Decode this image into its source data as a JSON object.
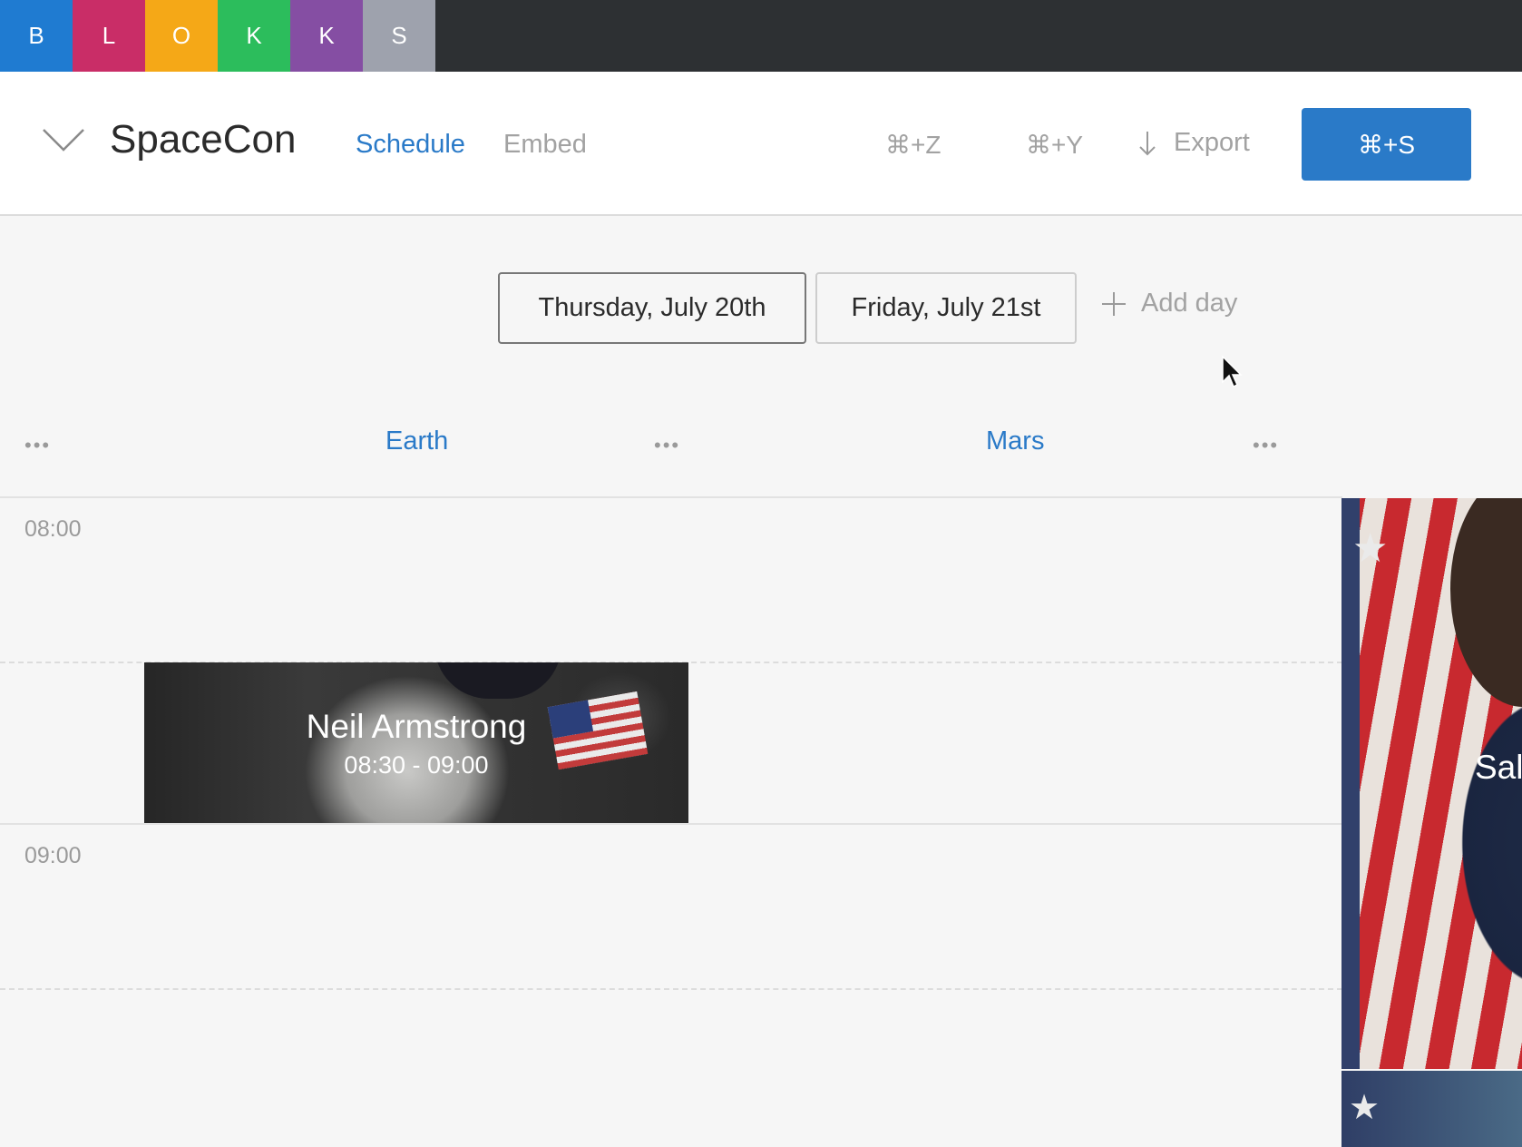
{
  "topbar": {
    "blocks": [
      {
        "letter": "B",
        "color": "#1f7bd1"
      },
      {
        "letter": "L",
        "color": "#c92d67"
      },
      {
        "letter": "O",
        "color": "#f5a817"
      },
      {
        "letter": "K",
        "color": "#2cbd5c"
      },
      {
        "letter": "K",
        "color": "#854ea3"
      },
      {
        "letter": "S",
        "color": "#9ea2ad"
      }
    ]
  },
  "header": {
    "title": "SpaceCon",
    "tabs": {
      "schedule": "Schedule",
      "embed": "Embed"
    },
    "undo": "⌘+Z",
    "redo": "⌘+Y",
    "export": "Export",
    "save": "⌘+S"
  },
  "days": {
    "items": [
      "Thursday, July 20th",
      "Friday, July 21st"
    ],
    "add": "Add day"
  },
  "columns": {
    "earth": "Earth",
    "mars": "Mars",
    "menu": "•••"
  },
  "times": [
    "08:00",
    "09:00"
  ],
  "sessions": {
    "main": {
      "name": "Neil Armstrong",
      "time": "08:30 - 09:00"
    },
    "right": {
      "name": "Sal"
    }
  },
  "colors": {
    "accent": "#2a7ac8",
    "topbar": "#2d3033"
  }
}
